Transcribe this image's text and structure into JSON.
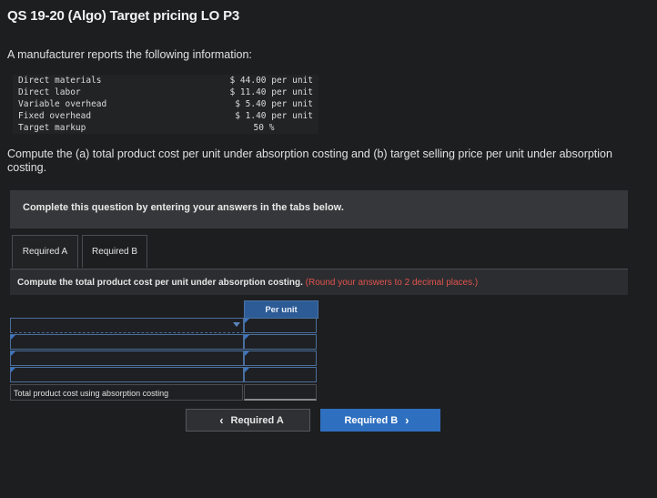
{
  "page": {
    "title": "QS 19-20 (Algo) Target pricing LO P3",
    "intro": "A manufacturer reports the following information:",
    "prompt": "Compute the (a) total product cost per unit under absorption costing and (b) target selling price per unit under absorption costing."
  },
  "info": {
    "rows": [
      {
        "label": "Direct materials",
        "value": "$ 44.00 per unit"
      },
      {
        "label": "Direct labor",
        "value": "$ 11.40 per unit"
      },
      {
        "label": "Variable overhead",
        "value": "$ 5.40 per unit"
      },
      {
        "label": "Fixed overhead",
        "value": "$ 1.40 per unit"
      },
      {
        "label": "Target markup",
        "value": "50 %"
      }
    ]
  },
  "banner": {
    "text": "Complete this question by entering your answers in the tabs below."
  },
  "tabs": {
    "a": "Required A",
    "b": "Required B"
  },
  "question": {
    "text": "Compute the total product cost per unit under absorption costing.",
    "note": "(Round your answers to 2 decimal places.)"
  },
  "grid": {
    "header": "Per unit",
    "total_label": "Total product cost using absorption costing",
    "row1_value": "",
    "row2_value": "",
    "row3_value": "",
    "total_value": ""
  },
  "nav": {
    "prev": "Required A",
    "next": "Required B"
  },
  "colors": {
    "accent": "#2e6fbf",
    "warning": "#e0534f",
    "header_bg": "#2c5b95"
  },
  "icons": {
    "prev": "chevron-left-icon",
    "next": "chevron-right-icon",
    "dropdown": "chevron-down-icon"
  }
}
